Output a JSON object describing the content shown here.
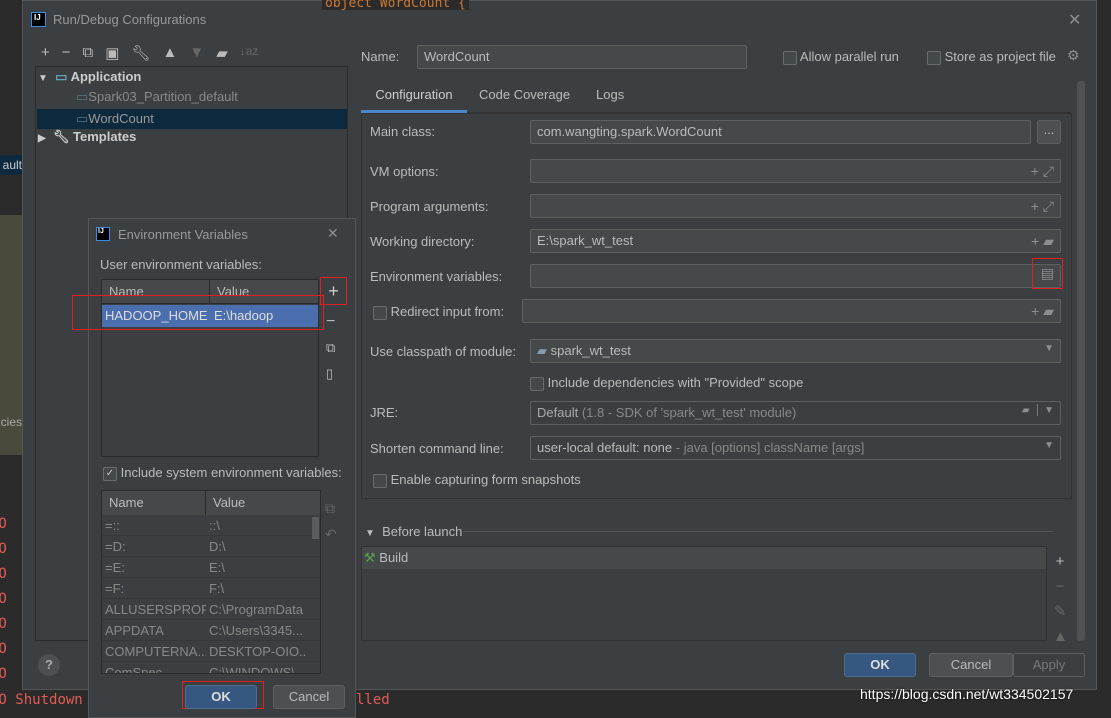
{
  "background": {
    "editor_text": "object WordCount {",
    "tree_fragment": "ault",
    "editor_fragment": "cies.",
    "console_prefix": "FO",
    "console_shutdown": "Shutdown",
    "console_suffix": "lled"
  },
  "dialog": {
    "title": "Run/Debug Configurations",
    "tree": {
      "items": [
        {
          "label": "Application",
          "bold": true,
          "expanded": true
        },
        {
          "label": "Spark03_Partition_default"
        },
        {
          "label": "WordCount",
          "selected": true
        },
        {
          "label": "Templates",
          "bold": true,
          "expanded": false
        }
      ]
    },
    "name_label": "Name:",
    "name_value": "WordCount",
    "allow_parallel_label": "Allow parallel run",
    "store_label": "Store as project file",
    "tabs": [
      "Configuration",
      "Code Coverage",
      "Logs"
    ],
    "form": {
      "main_class_label": "Main class:",
      "main_class": "com.wangting.spark.WordCount",
      "vm_label": "VM options:",
      "args_label": "Program arguments:",
      "workdir_label": "Working directory:",
      "workdir": "E:\\spark_wt_test",
      "env_label": "Environment variables:",
      "redirect_label": "Redirect input from:",
      "classpath_label": "Use classpath of module:",
      "classpath": "spark_wt_test",
      "include_deps_label": "Include dependencies with \"Provided\" scope",
      "jre_label": "JRE:",
      "jre_value": "Default",
      "jre_hint": "(1.8 - SDK of 'spark_wt_test' module)",
      "shorten_label": "Shorten command line:",
      "shorten_value": "user-local default: none",
      "shorten_hint": "- java [options] className [args]",
      "snapshots_label": "Enable capturing form snapshots"
    },
    "before_launch_label": "Before launch",
    "build_label": "Build",
    "ok": "OK",
    "cancel": "Cancel",
    "apply": "Apply",
    "help": "?"
  },
  "env_dialog": {
    "title": "Environment Variables",
    "user_label": "User environment variables:",
    "columns": [
      "Name",
      "Value"
    ],
    "user_rows": [
      {
        "name": "HADOOP_HOME",
        "value": "E:\\hadoop"
      }
    ],
    "include_system_label": "Include system environment variables:",
    "system_rows": [
      {
        "name": "=::",
        "value": "::\\"
      },
      {
        "name": "=D:",
        "value": "D:\\"
      },
      {
        "name": "=E:",
        "value": "E:\\"
      },
      {
        "name": "=F:",
        "value": "F:\\"
      },
      {
        "name": "ALLUSERSPROF...",
        "value": "C:\\ProgramData"
      },
      {
        "name": "APPDATA",
        "value": "C:\\Users\\3345..."
      },
      {
        "name": "COMPUTERNA...",
        "value": "DESKTOP-OIO..."
      },
      {
        "name": "ComSpec",
        "value": "C:\\WINDOWS\\..."
      }
    ],
    "ok": "OK",
    "cancel": "Cancel"
  },
  "watermark": "https://blog.csdn.net/wt334502157"
}
